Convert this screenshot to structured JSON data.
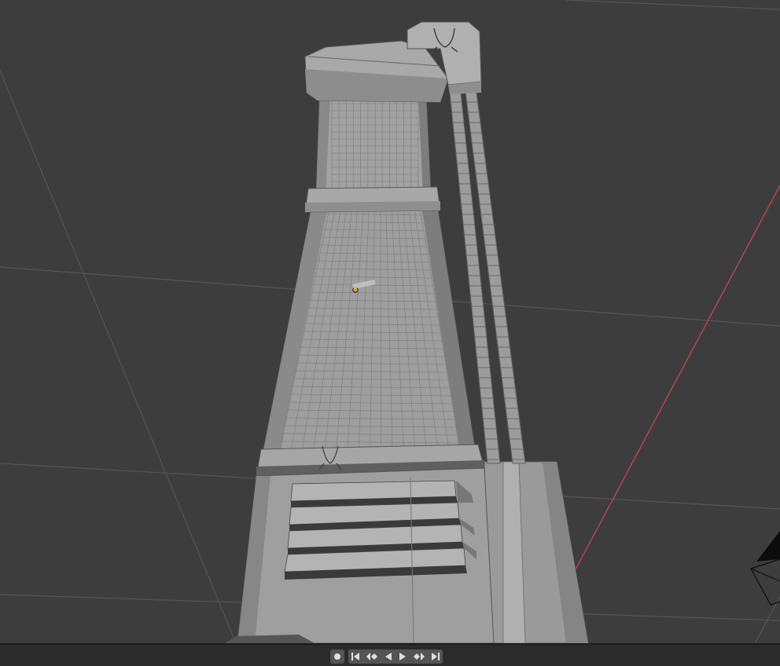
{
  "app": "3D Viewport",
  "viewport": {
    "background": "#3d3d3d",
    "grid_color": "#5a5a5a",
    "x_axis_color": "#c0424f",
    "origin_color": "#e89a2a",
    "object_color": "#8f8f8f",
    "object_shadow_color": "#6f6f6f",
    "gizmo_color": "#000000"
  },
  "timeline": {
    "buttons": [
      {
        "name": "record-button",
        "icon": "record-icon"
      },
      {
        "name": "jump-to-start-button",
        "icon": "jump-to-start-icon"
      },
      {
        "name": "previous-keyframe-button",
        "icon": "previous-keyframe-icon"
      },
      {
        "name": "play-reverse-button",
        "icon": "play-reverse-icon"
      },
      {
        "name": "play-button",
        "icon": "play-icon"
      },
      {
        "name": "next-keyframe-button",
        "icon": "next-keyframe-icon"
      },
      {
        "name": "jump-to-end-button",
        "icon": "jump-to-end-icon"
      }
    ]
  }
}
